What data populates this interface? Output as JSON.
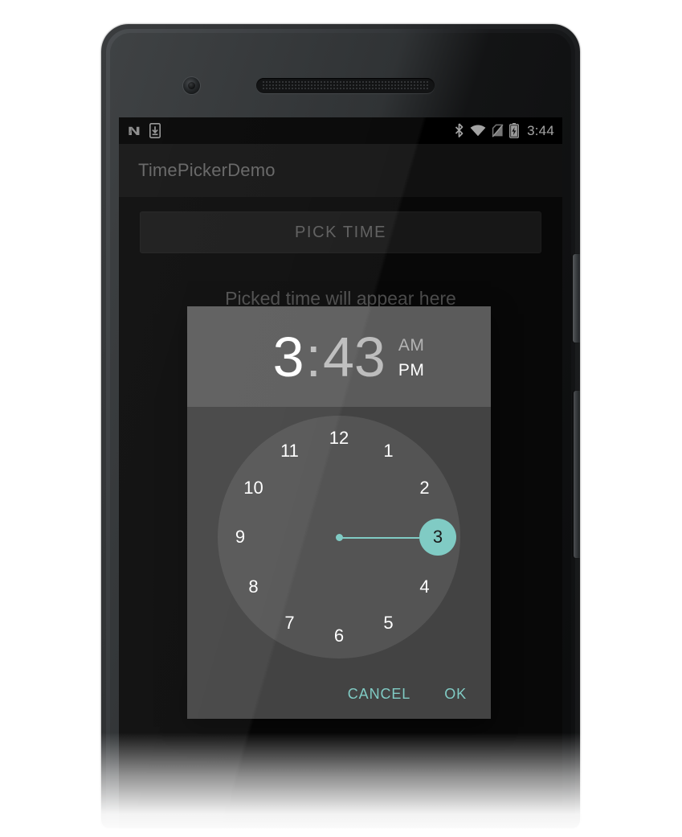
{
  "device": {
    "name": "android-phone-mockup",
    "camera_icon": "front-camera",
    "speaker_icon": "earpiece-speaker",
    "power_button": "power-button",
    "volume_button": "volume-rocker"
  },
  "statusbar": {
    "left_icons": [
      {
        "name": "android-n-icon",
        "label": "N"
      },
      {
        "name": "download-icon",
        "label": "↓"
      }
    ],
    "right_icons": [
      {
        "name": "bluetooth-icon"
      },
      {
        "name": "wifi-icon"
      },
      {
        "name": "no-sim-icon"
      },
      {
        "name": "battery-charging-icon"
      }
    ],
    "time": "3:44"
  },
  "appbar": {
    "title": "TimePickerDemo"
  },
  "main": {
    "pick_time_button": "PICK TIME",
    "result_placeholder": "Picked time will appear here"
  },
  "dialog": {
    "name": "time-picker-dialog",
    "header": {
      "hour": "3",
      "separator": ":",
      "minute": "43",
      "am_label": "AM",
      "pm_label": "PM",
      "selected_period": "PM",
      "selected_field": "hour"
    },
    "clock": {
      "mode": "hours",
      "selected_value": "3",
      "numbers": [
        "12",
        "1",
        "2",
        "3",
        "4",
        "5",
        "6",
        "7",
        "8",
        "9",
        "10",
        "11"
      ]
    },
    "actions": {
      "cancel": "CANCEL",
      "ok": "OK"
    }
  },
  "colors": {
    "accent_teal": "#80cbc4",
    "dialog_body": "#434343",
    "dialog_header": "#5b5b5b",
    "clock_face": "#545454",
    "appbar": "#1b1b1b",
    "screen_bg": "#0d0d0d",
    "statusbar": "#000000"
  }
}
